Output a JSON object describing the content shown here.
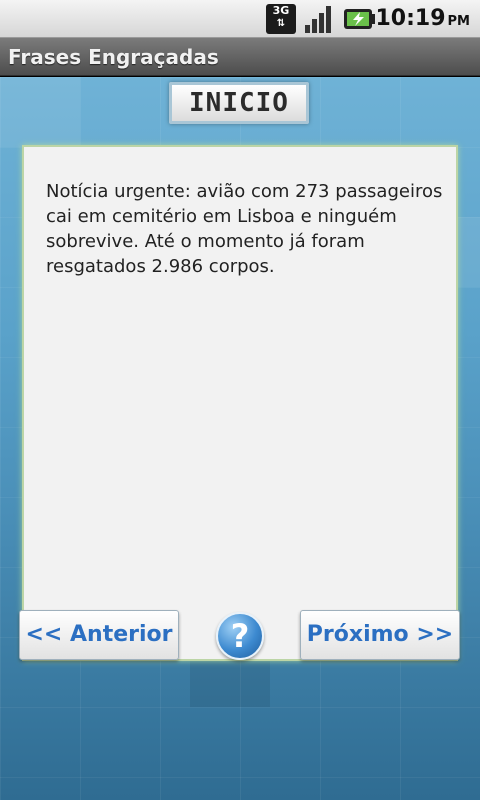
{
  "status_bar": {
    "network_label": "3G",
    "network_icon": "3g-data-icon",
    "signal_icon": "signal-strength-icon",
    "battery_icon": "battery-charging-icon",
    "time": "10:19",
    "ampm": "PM"
  },
  "app": {
    "title": "Frases Engraçadas"
  },
  "main": {
    "inicio_label": "INICIO",
    "phrase": "Notícia urgente: avião com 273 passageiros cai em cemitério em Lisboa e ninguém sobrevive. Até o momento já foram resgatados 2.986 corpos.",
    "prev_label": "<< Anterior",
    "help_label": "?",
    "next_label": "Próximo >>"
  },
  "colors": {
    "accent": "#2b6fc2",
    "background": "#5aa2ca",
    "card": "#f2f2f2"
  }
}
